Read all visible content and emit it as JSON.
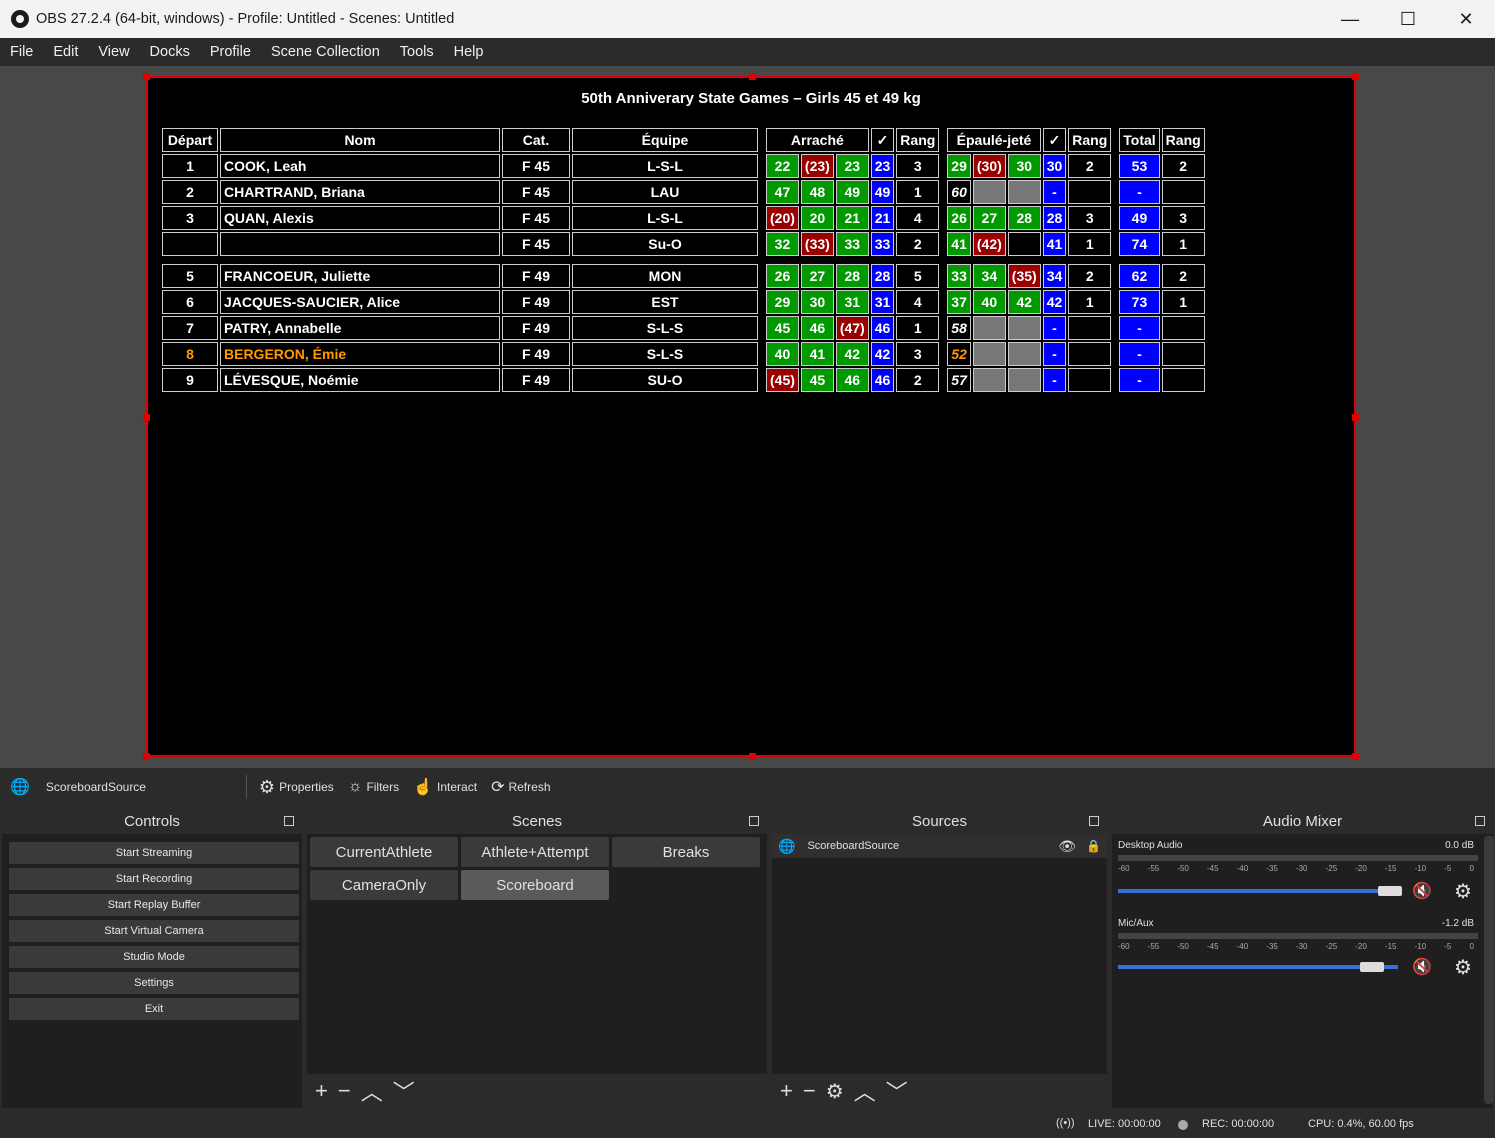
{
  "window": {
    "title": "OBS 27.2.4 (64-bit, windows) - Profile: Untitled - Scenes: Untitled",
    "minimize": "—",
    "maximize": "☐",
    "close": "✕"
  },
  "menu": [
    "File",
    "Edit",
    "View",
    "Docks",
    "Profile",
    "Scene Collection",
    "Tools",
    "Help"
  ],
  "scoreboard": {
    "title": "50th Anniverary State Games – Girls 45 et 49 kg",
    "headers": [
      "Départ",
      "Nom",
      "Cat.",
      "Équipe",
      "Arraché",
      "✓",
      "Rang",
      "Épaulé-jeté",
      "✓",
      "Rang",
      "Total",
      "Rang"
    ],
    "rows": [
      {
        "depart": "1",
        "nom": "COOK, Leah",
        "cat": "F 45",
        "equipe": "L-S-L",
        "a1": "22",
        "a2": "(23)",
        "a3": "23",
        "abest": "23",
        "arang": "3",
        "e1": "29",
        "e2": "(30)",
        "e3": "30",
        "ebest": "30",
        "erang": "2",
        "total": "53",
        "trang": "2"
      },
      {
        "depart": "2",
        "nom": "CHARTRAND, Briana",
        "cat": "F 45",
        "equipe": "LAU",
        "a1": "47",
        "a2": "48",
        "a3": "49",
        "abest": "49",
        "arang": "1",
        "e1": "60",
        "e2": "",
        "e3": "",
        "ebest": "-",
        "erang": "",
        "total": "-",
        "trang": ""
      },
      {
        "depart": "3",
        "nom": "QUAN, Alexis",
        "cat": "F 45",
        "equipe": "L-S-L",
        "a1": "(20)",
        "a2": "20",
        "a3": "21",
        "abest": "21",
        "arang": "4",
        "e1": "26",
        "e2": "27",
        "e3": "28",
        "ebest": "28",
        "erang": "3",
        "total": "49",
        "trang": "3"
      },
      {
        "depart": "",
        "nom": "",
        "cat": "F 45",
        "equipe": "Su-O",
        "a1": "32",
        "a2": "(33)",
        "a3": "33",
        "abest": "33",
        "arang": "2",
        "e1": "41",
        "e2": "(42)",
        "e3": "",
        "ebest": "41",
        "erang": "1",
        "total": "74",
        "trang": "1"
      },
      {
        "depart": "5",
        "nom": "FRANCOEUR, Juliette",
        "cat": "F 49",
        "equipe": "MON",
        "a1": "26",
        "a2": "27",
        "a3": "28",
        "abest": "28",
        "arang": "5",
        "e1": "33",
        "e2": "34",
        "e3": "(35)",
        "ebest": "34",
        "erang": "2",
        "total": "62",
        "trang": "2"
      },
      {
        "depart": "6",
        "nom": "JACQUES-SAUCIER, Alice",
        "cat": "F 49",
        "equipe": "EST",
        "a1": "29",
        "a2": "30",
        "a3": "31",
        "abest": "31",
        "arang": "4",
        "e1": "37",
        "e2": "40",
        "e3": "42",
        "ebest": "42",
        "erang": "1",
        "total": "73",
        "trang": "1"
      },
      {
        "depart": "7",
        "nom": "PATRY, Annabelle",
        "cat": "F 49",
        "equipe": "S-L-S",
        "a1": "45",
        "a2": "46",
        "a3": "(47)",
        "abest": "46",
        "arang": "1",
        "e1": "58",
        "e2": "",
        "e3": "",
        "ebest": "-",
        "erang": "",
        "total": "-",
        "trang": ""
      },
      {
        "depart": "8",
        "nom": "BERGERON, Émie",
        "cat": "F 49",
        "equipe": "S-L-S",
        "a1": "40",
        "a2": "41",
        "a3": "42",
        "abest": "42",
        "arang": "3",
        "e1": "52",
        "e2": "",
        "e3": "",
        "ebest": "-",
        "erang": "",
        "total": "-",
        "trang": ""
      },
      {
        "depart": "9",
        "nom": "LÉVESQUE, Noémie",
        "cat": "F 49",
        "equipe": "SU-O",
        "a1": "(45)",
        "a2": "45",
        "a3": "46",
        "abest": "46",
        "arang": "2",
        "e1": "57",
        "e2": "",
        "e3": "",
        "ebest": "-",
        "erang": "",
        "total": "-",
        "trang": ""
      }
    ]
  },
  "source_toolbar": {
    "source_name": "ScoreboardSource",
    "properties": "Properties",
    "filters": "Filters",
    "interact": "Interact",
    "refresh": "Refresh"
  },
  "controls": {
    "title": "Controls",
    "buttons": [
      "Start Streaming",
      "Start Recording",
      "Start Replay Buffer",
      "Start Virtual Camera",
      "Studio Mode",
      "Settings",
      "Exit"
    ]
  },
  "scenes": {
    "title": "Scenes",
    "items": [
      "CurrentAthlete",
      "Athlete+Attempt",
      "Breaks",
      "CameraOnly",
      "Scoreboard"
    ],
    "active": "Scoreboard"
  },
  "sources": {
    "title": "Sources",
    "items": [
      "ScoreboardSource"
    ]
  },
  "mixer": {
    "title": "Audio Mixer",
    "scale": [
      "-60",
      "-55",
      "-50",
      "-45",
      "-40",
      "-35",
      "-30",
      "-25",
      "-20",
      "-15",
      "-10",
      "-5",
      "0"
    ],
    "channels": [
      {
        "name": "Desktop Audio",
        "db": "0.0 dB",
        "volume": 1.0
      },
      {
        "name": "Mic/Aux",
        "db": "-1.2 dB",
        "volume": 0.93
      }
    ]
  },
  "status": {
    "live": "LIVE: 00:00:00",
    "rec": "REC: 00:00:00",
    "cpu": "CPU: 0.4%, 60.00 fps"
  }
}
